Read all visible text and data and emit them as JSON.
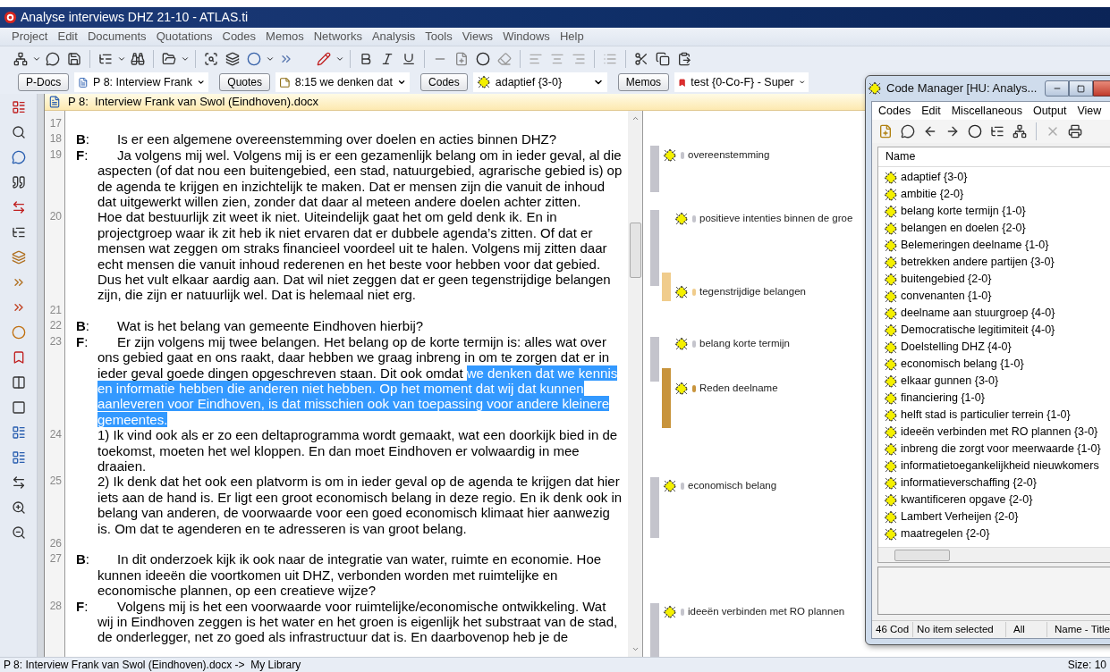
{
  "window": {
    "title": "Analyse interviews DHZ 21-10 - ATLAS.ti"
  },
  "menu": [
    "Project",
    "Edit",
    "Documents",
    "Quotations",
    "Codes",
    "Memos",
    "Networks",
    "Analysis",
    "Tools",
    "Views",
    "Windows",
    "Help"
  ],
  "selectors": [
    {
      "button": "P-Docs",
      "value": "P 8: Interview Frank",
      "kind": "document"
    },
    {
      "button": "Quotes",
      "value": "8:15 we denken dat",
      "kind": "quote"
    },
    {
      "button": "Codes",
      "value": "adaptief {3-0}",
      "kind": "code"
    },
    {
      "button": "Memos",
      "value": "test {0-Co-F} - Super",
      "kind": "memo"
    }
  ],
  "document": {
    "title": "P 8:  Interview Frank van Swol (Eindhoven).docx",
    "lines": [
      {
        "number": "17"
      },
      {
        "number": "18",
        "speaker": "**B**:",
        "segments": [
          {
            "text": "Is er een algemene overeenstemming over doelen en acties binnen DHZ?",
            "selected": false
          }
        ]
      },
      {
        "number": "19",
        "speaker": "**F**:",
        "segments": [
          {
            "text": "Ja volgens mij wel. Volgens mij is er een gezamenlijk belang om in ieder geval, al die aspecten (of dat nou een buitengebied, een stad, natuurgebied, agrarische gebied is) op de agenda te krijgen en inzichtelijk te maken. Dat er mensen zijn die vanuit de inhoud dat uitgewerkt willen zien, zonder dat daar al meteen andere doelen achter zitten.",
            "selected": false
          }
        ]
      },
      {
        "number": "20",
        "segments": [
          {
            "text": "Hoe dat bestuurlijk zit weet ik niet. Uiteindelijk gaat het om geld denk ik. En in projectgroep waar ik zit heb ik niet ervaren dat er dubbele agenda’s zitten. Of dat er mensen wat zeggen om straks financieel voordeel uit te halen. Volgens mij zitten daar echt mensen die vanuit inhoud rederenen en het beste voor hebben voor dat gebied. Dus het vult elkaar aardig aan. Dat wil niet zeggen dat er geen tegenstrijdige belangen zijn, die zijn er natuurlijk wel. Dat is helemaal niet erg.",
            "selected": false
          }
        ]
      },
      {
        "number": "21"
      },
      {
        "number": "22",
        "speaker": "**B**:",
        "segments": [
          {
            "text": "Wat is het belang van gemeente Eindhoven hierbij?",
            "selected": false
          }
        ]
      },
      {
        "number": "23",
        "speaker": "**F**:",
        "segments": [
          {
            "text": "Er zijn volgens mij twee belangen. Het belang op de korte termijn is: alles wat over ons gebied gaat en ons raakt, daar hebben we graag inbreng in om te zorgen dat er in ieder geval goede dingen opgeschreven staan. Dit ook omdat ",
            "selected": false
          },
          {
            "text": "we denken dat we kennis en informatie hebben die anderen niet hebben. Op het moment dat wij dat kunnen aanleveren voor Eindhoven, is dat misschien ook van toepassing voor andere kleinere gemeentes.",
            "selected": true
          }
        ]
      },
      {
        "number": "24",
        "segments": [
          {
            "text": "1)  Ik vind ook als er zo een deltaprogramma wordt gemaakt, wat een doorkijk bied in de toekomst, moeten het wel kloppen. En dan moet Eindhoven er volwaardig in mee draaien.",
            "selected": false
          }
        ]
      },
      {
        "number": "25",
        "segments": [
          {
            "text": "2) Ik denk dat het ook een platvorm is om in ieder geval op de agenda te krijgen dat hier iets aan de hand is. Er ligt een groot economisch belang in deze regio. En ik denk ook in belang van anderen, de voorwaarde voor een goed economisch klimaat hier aanwezig is. Om dat te agenderen en te adresseren is van groot belang.",
            "selected": false
          }
        ]
      },
      {
        "number": "26"
      },
      {
        "number": "27",
        "speaker": "**B**:",
        "segments": [
          {
            "text": "In dit onderzoek kijk ik ook naar de integratie van water, ruimte en economie. Hoe kunnen ideeën die voortkomen uit DHZ, verbonden worden met ruimtelijke en economische plannen, op een creatieve wijze?",
            "selected": false
          }
        ]
      },
      {
        "number": "28",
        "speaker": "**F**:",
        "segments": [
          {
            "text": "Volgens mij is het een voorwaarde voor ruimtelijke/economische ontwikkeling. Wat wij in Eindhoven zeggen is het water en het groen is eigenlijk het substraat van de stad, de onderlegger, net zo goed als infrastructuur dat is. En daarbovenop heb je de",
            "selected": false
          }
        ]
      }
    ]
  },
  "margin_codes": [
    {
      "label": "overeenstemming",
      "color": "#c4c4cc"
    },
    {
      "label": "positieve intenties binnen de groe",
      "color": "#c4c4cc"
    },
    {
      "label": "tegenstrijdige belangen",
      "color": "#f0cc8c"
    },
    {
      "label": "belang korte termijn",
      "color": "#c4c4cc"
    },
    {
      "label": "Reden deelname",
      "color": "#c8943c"
    },
    {
      "label": "economisch belang",
      "color": "#c4c4cc"
    },
    {
      "label": "ideeën verbinden met RO plannen",
      "color": "#c4c4cc"
    }
  ],
  "status_bar": {
    "path": "P 8: Interview Frank van Swol (Eindhoven).docx ->  My Library",
    "size": "Size: 10"
  },
  "code_manager": {
    "title": "Code Manager [HU: Analys...",
    "menu": [
      "Codes",
      "Edit",
      "Miscellaneous",
      "Output",
      "View"
    ],
    "column": "Name",
    "codes": [
      "adaptief {3-0}",
      "ambitie {2-0}",
      "belang korte termijn {1-0}",
      "belangen en doelen {2-0}",
      "Belemeringen deelname {1-0}",
      "betrekken andere partijen {3-0}",
      "buitengebied {2-0}",
      "convenanten {1-0}",
      "deelname aan stuurgroep {4-0}",
      "Democratische legitimiteit {4-0}",
      "Doelstelling DHZ {4-0}",
      "economisch belang {1-0}",
      "elkaar gunnen {3-0}",
      "financiering {1-0}",
      "helft stad is particulier terrein {1-0}",
      "ideeën verbinden met RO plannen {3-0}",
      "inbreng die zorgt voor meerwaarde {1-0}",
      "informatietoegankelijkheid nieuwkomers",
      "informatieverschaffing {2-0}",
      "kwantificeren opgave {2-0}",
      "Lambert Verheijen {2-0}",
      "maatregelen {2-0}"
    ],
    "status": [
      "46 Cod",
      "No item selected",
      "All",
      "Name - Title"
    ]
  }
}
